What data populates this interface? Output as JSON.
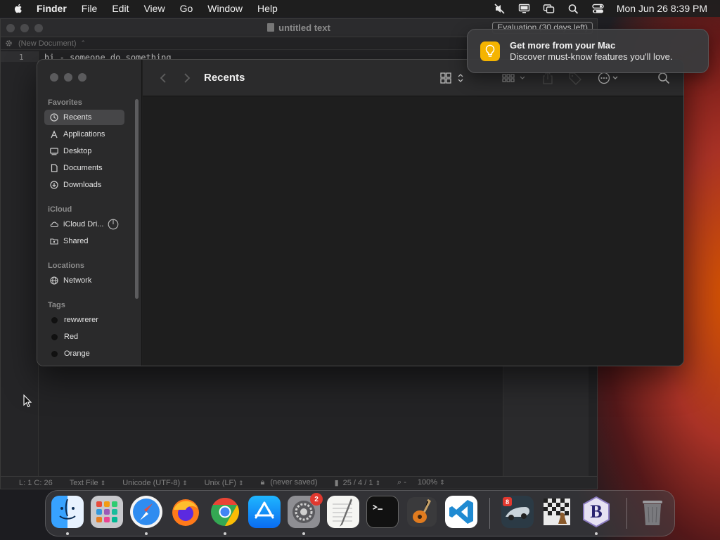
{
  "menubar": {
    "app_name": "Finder",
    "menus": [
      "File",
      "Edit",
      "View",
      "Go",
      "Window",
      "Help"
    ],
    "clock": "Mon Jun 26  8:39 PM",
    "status_icons": [
      "mute-icon",
      "display-icon",
      "screen-mirroring-icon",
      "spotlight-icon",
      "control-center-icon"
    ]
  },
  "editor": {
    "title": "untitled text",
    "evaluation_badge": "Evaluation (30 days left)",
    "path_label": "(New Document)",
    "line_number": "1",
    "code_line": "hi - someone do something",
    "status": {
      "position": "L: 1 C: 26",
      "syntax": "Text File",
      "encoding": "Unicode (UTF-8)",
      "line_endings": "Unix (LF)",
      "save_state": "(never saved)",
      "counts": "25 / 4 / 1",
      "zoom": "100%"
    }
  },
  "finder": {
    "folder_title": "Recents",
    "sidebar": {
      "favorites_label": "Favorites",
      "favorites": [
        {
          "label": "Recents",
          "icon": "clock-icon",
          "selected": true
        },
        {
          "label": "Applications",
          "icon": "applications-icon",
          "selected": false
        },
        {
          "label": "Desktop",
          "icon": "desktop-icon",
          "selected": false
        },
        {
          "label": "Documents",
          "icon": "document-icon",
          "selected": false
        },
        {
          "label": "Downloads",
          "icon": "download-icon",
          "selected": false
        }
      ],
      "icloud_label": "iCloud",
      "icloud": [
        {
          "label": "iCloud Dri...",
          "icon": "cloud-icon"
        },
        {
          "label": "Shared",
          "icon": "shared-folder-icon"
        }
      ],
      "locations_label": "Locations",
      "locations": [
        {
          "label": "Network",
          "icon": "network-icon"
        }
      ],
      "tags_label": "Tags",
      "tags": [
        {
          "label": "rewwrerer",
          "color": "#111111"
        },
        {
          "label": "Red",
          "color": "#111111"
        },
        {
          "label": "Orange",
          "color": "#111111"
        }
      ]
    }
  },
  "notification": {
    "title": "Get more from your Mac",
    "body": "Discover must-know features you'll love.",
    "icon": "lightbulb-icon",
    "accent": "#f5b400"
  },
  "dock": {
    "apps": [
      {
        "name": "Finder",
        "icon": "finder-icon",
        "running": true
      },
      {
        "name": "Launchpad",
        "icon": "launchpad-icon",
        "running": false
      },
      {
        "name": "Safari",
        "icon": "safari-icon",
        "running": true
      },
      {
        "name": "Firefox",
        "icon": "firefox-icon",
        "running": false
      },
      {
        "name": "Google Chrome",
        "icon": "chrome-icon",
        "running": true
      },
      {
        "name": "App Store",
        "icon": "app-store-icon",
        "running": false
      },
      {
        "name": "System Settings",
        "icon": "system-settings-icon",
        "running": true,
        "badge": "2"
      },
      {
        "name": "TextEdit",
        "icon": "textedit-icon",
        "running": false
      },
      {
        "name": "Terminal",
        "icon": "terminal-icon",
        "running": false
      },
      {
        "name": "GarageBand",
        "icon": "garageband-icon",
        "running": false
      },
      {
        "name": "Visual Studio Code",
        "icon": "vscode-icon",
        "running": false
      },
      {
        "name": "Racing Game",
        "icon": "racing-game-icon",
        "running": false
      },
      {
        "name": "Chess",
        "icon": "chess-icon",
        "running": false
      },
      {
        "name": "BBEdit",
        "icon": "bbedit-icon",
        "running": true
      },
      {
        "name": "Trash",
        "icon": "trash-icon",
        "running": false
      }
    ],
    "racing_badge_text": "8",
    "bbedit_letter": "B"
  }
}
